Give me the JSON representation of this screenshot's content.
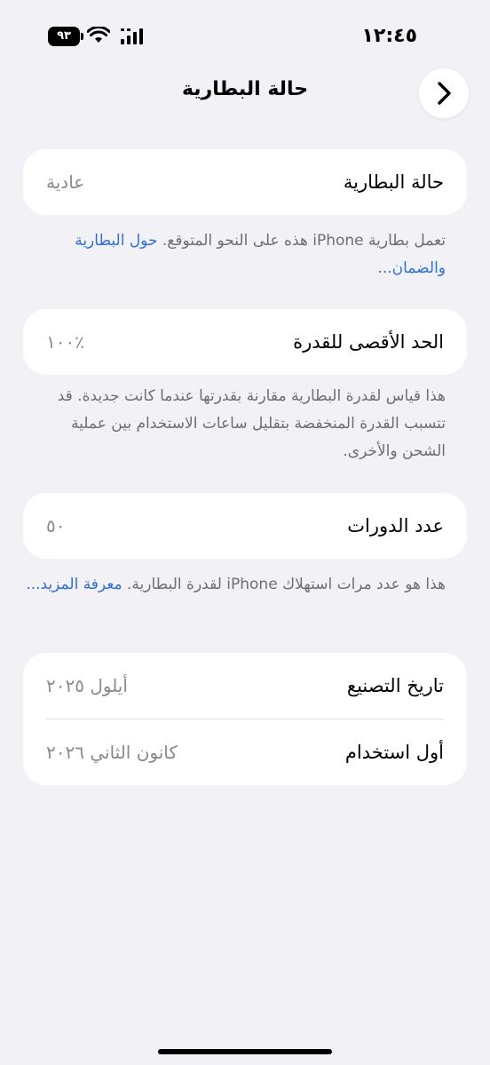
{
  "status_bar": {
    "time": "١٢:٤٥",
    "battery_level": "٩٣",
    "wifi_icon": "wifi-icon",
    "signal_icon": "cellular-signal-icon"
  },
  "nav": {
    "title": "حالة البطارية",
    "back_icon": "chevron-right-icon"
  },
  "battery_condition": {
    "label": "حالة البطارية",
    "value": "عادية",
    "footnote": "تعمل بطارية iPhone هذه على النحو المتوقع.",
    "footnote_link": "حول البطارية والضمان..."
  },
  "maximum_capacity": {
    "label": "الحد الأقصى للقدرة",
    "value": "٪١٠٠",
    "footnote": "هذا قياس لقدرة البطارية مقارنة بقدرتها عندما كانت جديدة. قد تتسبب القدرة المنخفضة بتقليل ساعات الاستخدام بين عملية الشحن والأخرى."
  },
  "cycle_count": {
    "label": "عدد الدورات",
    "value": "٥٠",
    "footnote": "هذا هو عدد مرات استهلاك iPhone لقدرة البطارية.",
    "footnote_link": "معرفة المزيد..."
  },
  "dates": {
    "manufacture_label": "تاريخ التصنيع",
    "manufacture_value": "أيلول ٢٠٢٥",
    "first_use_label": "أول استخدام",
    "first_use_value": "كانون الثاني ٢٠٢٦"
  },
  "colors": {
    "background": "#f1f1f6",
    "card": "#ffffff",
    "link": "#2f6fd6",
    "secondary_text": "#8a8a8e"
  }
}
